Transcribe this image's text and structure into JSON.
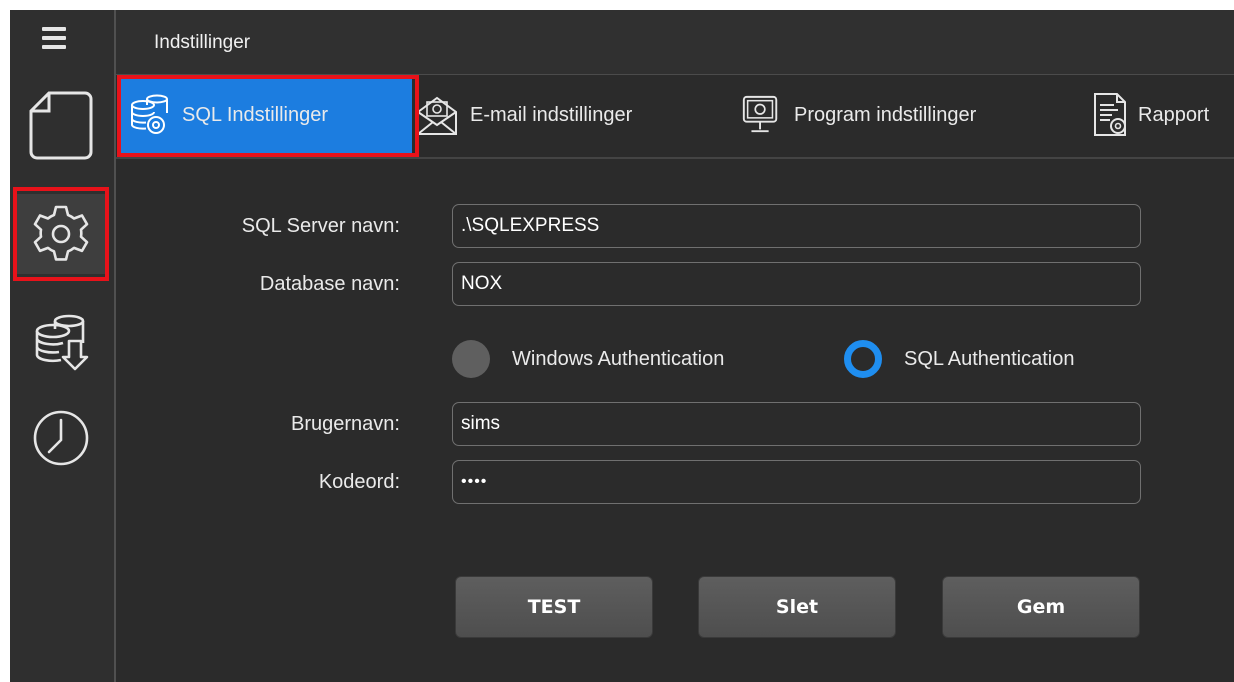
{
  "header": {
    "title": "Indstillinger"
  },
  "sidebar": {
    "items": [
      {
        "icon": "document-icon"
      },
      {
        "icon": "gear-icon"
      },
      {
        "icon": "database-export-icon"
      },
      {
        "icon": "clock-icon"
      }
    ]
  },
  "tabs": [
    {
      "label": "SQL Indstillinger",
      "icon": "database-gear-icon"
    },
    {
      "label": "E-mail indstillinger",
      "icon": "email-gear-icon"
    },
    {
      "label": "Program indstillinger",
      "icon": "monitor-gear-icon"
    },
    {
      "label": "Rapport",
      "icon": "report-gear-icon"
    }
  ],
  "form": {
    "server_label": "SQL Server navn:",
    "server_value": ".\\SQLEXPRESS",
    "db_label": "Database navn:",
    "db_value": "NOX",
    "auth_windows": "Windows Authentication",
    "auth_sql": "SQL Authentication",
    "auth_selected": "SQL Authentication",
    "user_label": "Brugernavn:",
    "user_value": "sims",
    "password_label": "Kodeord:",
    "password_value": "••••"
  },
  "buttons": {
    "test": "TEST",
    "delete": "Slet",
    "save": "Gem"
  },
  "colors": {
    "accent": "#1c7de0",
    "highlight": "#e8121a",
    "background": "#2b2b2b"
  }
}
